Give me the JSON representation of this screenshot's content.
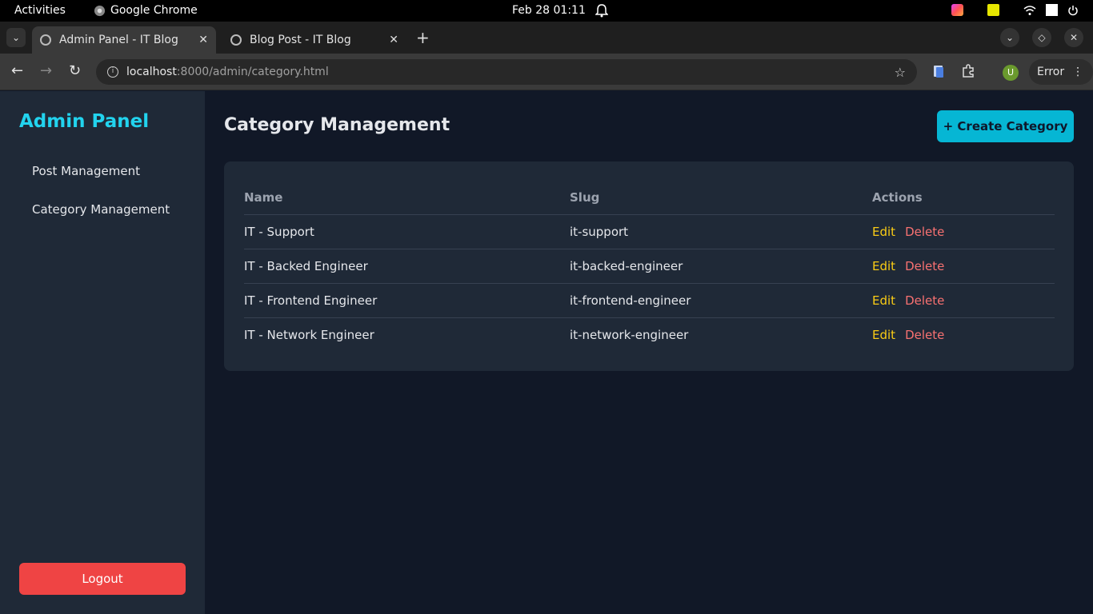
{
  "topbar": {
    "activities": "Activities",
    "app_name": "Google Chrome",
    "clock": "Feb 28  01:11"
  },
  "browser": {
    "tabs": [
      {
        "title": "Admin Panel - IT Blog"
      },
      {
        "title": "Blog Post - IT Blog"
      }
    ],
    "url_host": "localhost",
    "url_path": ":8000/admin/category.html",
    "profile_initial": "U",
    "error_label": "Error"
  },
  "sidebar": {
    "brand": "Admin Panel",
    "items": [
      {
        "label": "Post Management"
      },
      {
        "label": "Category Management"
      }
    ],
    "logout_label": "Logout"
  },
  "main": {
    "title": "Category Management",
    "create_label": "+ Create Category",
    "table": {
      "headers": {
        "name": "Name",
        "slug": "Slug",
        "actions": "Actions"
      },
      "rows": [
        {
          "name": "IT - Support",
          "slug": "it-support"
        },
        {
          "name": "IT - Backed Engineer",
          "slug": "it-backed-engineer"
        },
        {
          "name": "IT - Frontend Engineer",
          "slug": "it-frontend-engineer"
        },
        {
          "name": "IT - Network Engineer",
          "slug": "it-network-engineer"
        }
      ],
      "edit_label": "Edit",
      "delete_label": "Delete"
    }
  },
  "colors": {
    "brand": "#22d3ee",
    "create_button": "#06b6d4",
    "logout_button": "#ef4444",
    "edit": "#facc15",
    "delete": "#f87171"
  }
}
